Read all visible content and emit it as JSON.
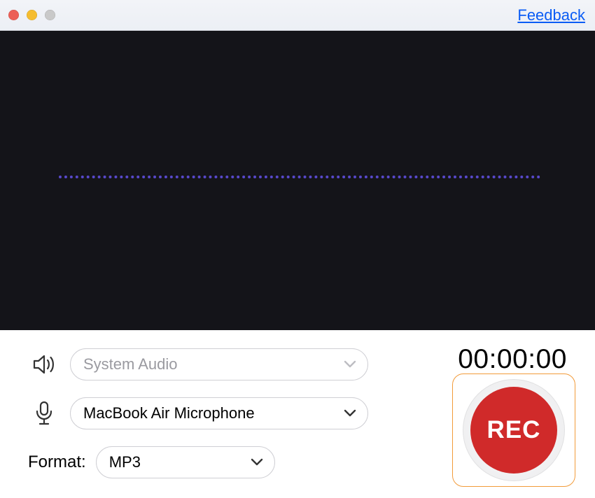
{
  "header": {
    "feedback_label": "Feedback"
  },
  "controls": {
    "system_audio_value": "System Audio",
    "microphone_value": "MacBook Air Microphone",
    "format_label": "Format:",
    "format_value": "MP3"
  },
  "recorder": {
    "timer": "00:00:00",
    "button_label": "REC"
  }
}
